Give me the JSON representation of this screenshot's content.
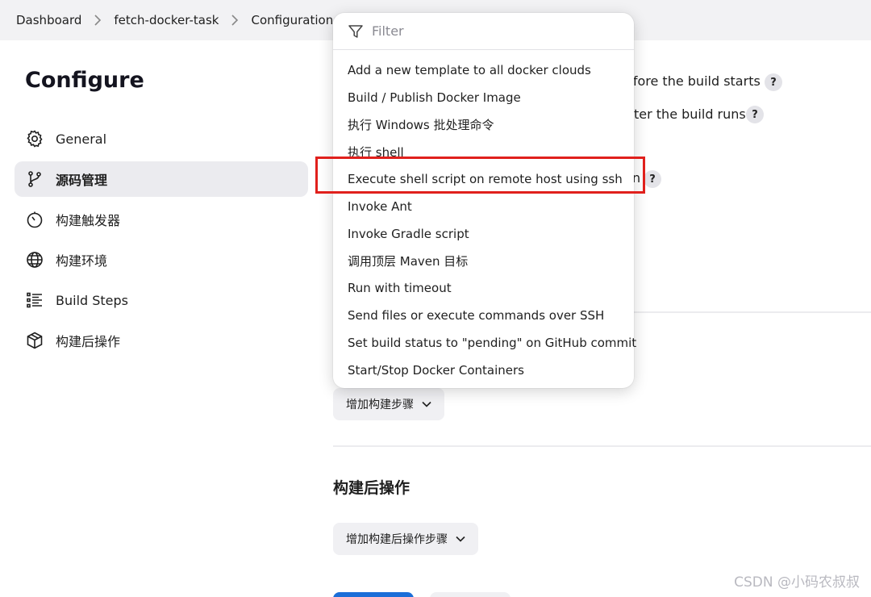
{
  "breadcrumb": {
    "items": [
      "Dashboard",
      "fetch-docker-task",
      "Configuration"
    ]
  },
  "page_title": "Configure",
  "sidebar": {
    "items": [
      {
        "label": "General",
        "icon": "gear-icon",
        "active": false
      },
      {
        "label": "源码管理",
        "icon": "branch-icon",
        "active": true
      },
      {
        "label": "构建触发器",
        "icon": "timer-icon",
        "active": false
      },
      {
        "label": "构建环境",
        "icon": "globe-icon",
        "active": false
      },
      {
        "label": "Build Steps",
        "icon": "list-icon",
        "active": false
      },
      {
        "label": "构建后操作",
        "icon": "cube-icon",
        "active": false
      }
    ]
  },
  "background_options": {
    "before_build": "efore the build starts",
    "after_build": "ter the build runs",
    "partial": "n"
  },
  "dropdown": {
    "filter_placeholder": "Filter",
    "items": [
      "Add a new template to all docker clouds",
      "Build / Publish Docker Image",
      "执行 Windows 批处理命令",
      "执行 shell",
      "Execute shell script on remote host using ssh",
      "Invoke Ant",
      "Invoke Gradle script",
      "调用顶层 Maven 目标",
      "Run with timeout",
      "Send files or execute commands over SSH",
      "Set build status to \"pending\" on GitHub commit",
      "Start/Stop Docker Containers"
    ],
    "highlighted_item": "Execute shell script on remote host using ssh"
  },
  "build_steps": {
    "add_button": "增加构建步骤"
  },
  "post_build": {
    "heading": "构建后操作",
    "add_button": "增加构建后操作步骤"
  },
  "help_label": "?",
  "watermark": "CSDN @小码农叔叔",
  "colors": {
    "highlight": "#e0201c",
    "primary": "#1b6ed8",
    "active_bg": "#ebebef"
  }
}
